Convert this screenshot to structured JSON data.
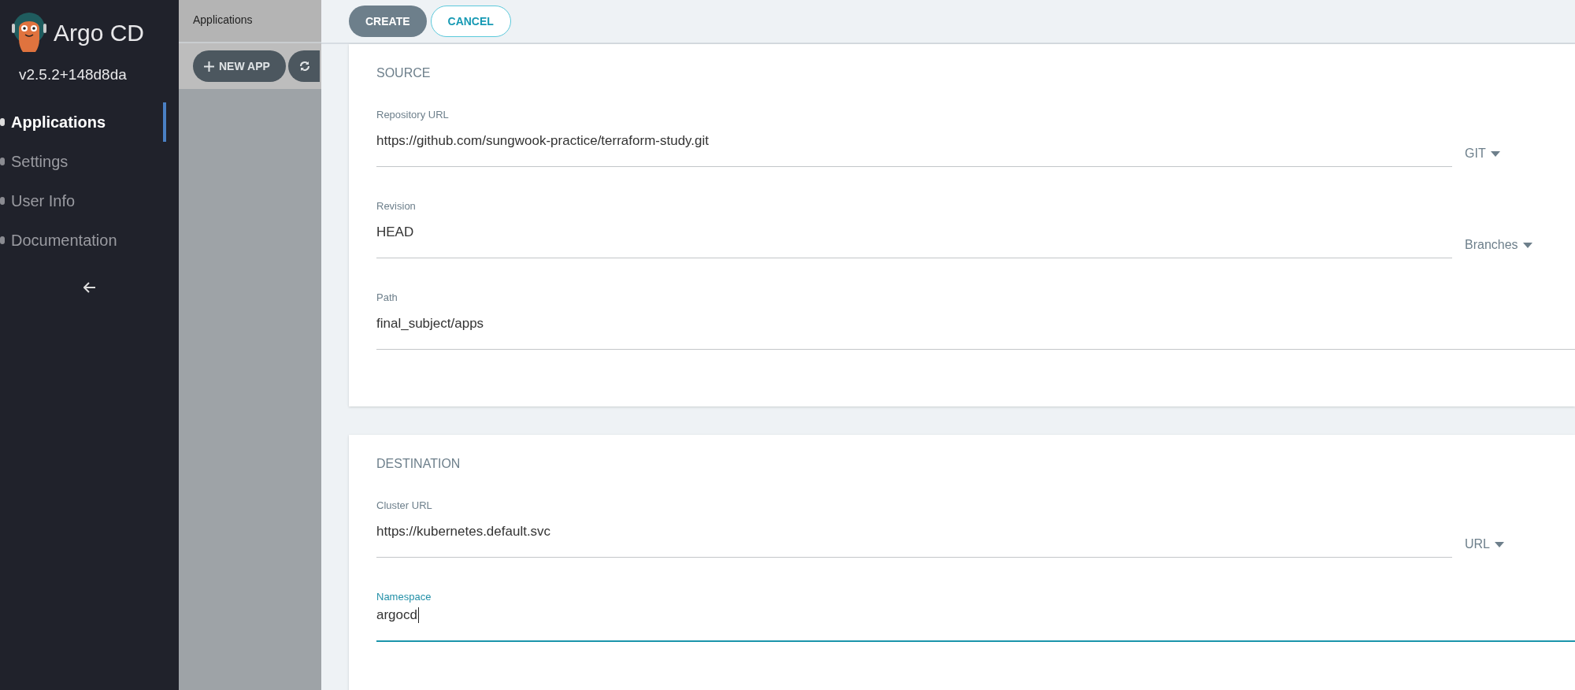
{
  "sidebar": {
    "title": "Argo CD",
    "version": "v2.5.2+148d8da",
    "nav": [
      {
        "label": "Applications",
        "selected": true
      },
      {
        "label": "Settings",
        "selected": false
      },
      {
        "label": "User Info",
        "selected": false
      },
      {
        "label": "Documentation",
        "selected": false
      }
    ]
  },
  "background_page": {
    "breadcrumb": "Applications",
    "buttons": [
      {
        "label": "NEW APP",
        "kind": "new"
      },
      {
        "kind": "sync"
      }
    ]
  },
  "panel": {
    "buttons": [
      {
        "label": "CREATE",
        "kind": "primary"
      },
      {
        "label": "CANCEL",
        "kind": "outline"
      }
    ],
    "sections": [
      {
        "title": "SOURCE",
        "fields": [
          {
            "label": "Repository URL",
            "value": "https://github.com/sungwook-practice/terraform-study.git",
            "focused": false,
            "dropdown": "GIT"
          },
          {
            "label": "Revision",
            "value": "HEAD",
            "focused": false,
            "dropdown": "Branches"
          },
          {
            "label": "Path",
            "value": "final_subject/apps",
            "focused": false
          }
        ]
      },
      {
        "title": "DESTINATION",
        "fields": [
          {
            "label": "Cluster URL",
            "value": "https://kubernetes.default.svc",
            "focused": false,
            "dropdown": "URL"
          },
          {
            "label": "Namespace",
            "value": "argocd",
            "focused": true
          }
        ]
      }
    ]
  }
}
